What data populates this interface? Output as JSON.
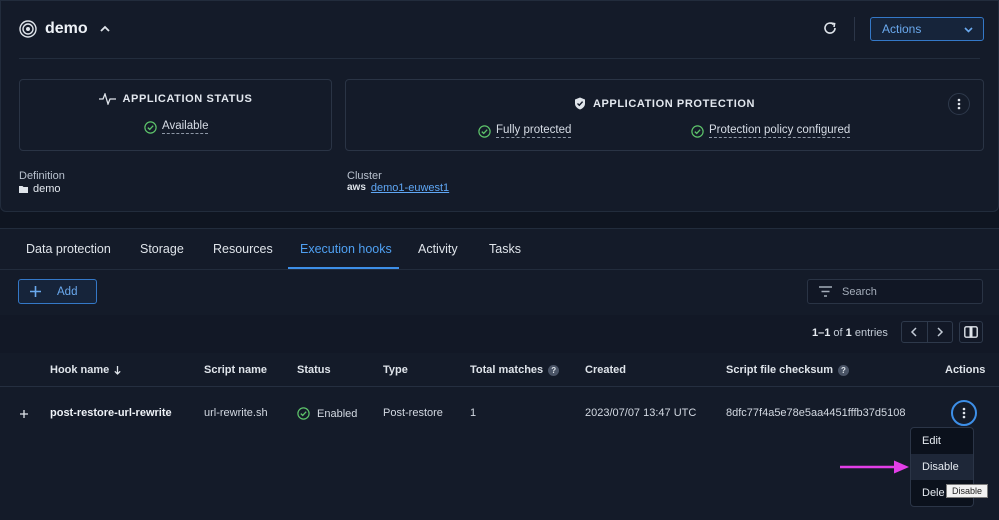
{
  "app": {
    "name": "demo",
    "actions_label": "Actions"
  },
  "status": {
    "title": "APPLICATION STATUS",
    "value": "Available"
  },
  "protection": {
    "title": "APPLICATION PROTECTION",
    "item1": "Fully protected",
    "item2": "Protection policy configured"
  },
  "definition": {
    "label": "Definition",
    "value": "demo"
  },
  "cluster": {
    "label": "Cluster",
    "provider": "aws",
    "value": "demo1-euwest1"
  },
  "tabs": [
    {
      "label": "Data protection"
    },
    {
      "label": "Storage"
    },
    {
      "label": "Resources"
    },
    {
      "label": "Execution hooks",
      "active": true
    },
    {
      "label": "Activity"
    },
    {
      "label": "Tasks"
    }
  ],
  "toolbar": {
    "add_label": "Add",
    "search_placeholder": "Search"
  },
  "pagination": {
    "range": "1–1",
    "of_word": "of",
    "total": "1",
    "entries_word": "entries"
  },
  "table": {
    "columns": {
      "hook_name": "Hook name",
      "script_name": "Script name",
      "status": "Status",
      "type": "Type",
      "total_matches": "Total matches",
      "created": "Created",
      "checksum": "Script file checksum",
      "actions": "Actions"
    },
    "rows": [
      {
        "hook_name": "post-restore-url-rewrite",
        "script_name": "url-rewrite.sh",
        "status": "Enabled",
        "type": "Post-restore",
        "total_matches": "1",
        "created": "2023/07/07 13:47 UTC",
        "checksum": "8dfc77f4a5e78e5aa4451fffb37d5108"
      }
    ]
  },
  "row_menu": {
    "items": [
      "Edit",
      "Disable",
      "Dele"
    ]
  },
  "tooltip": "Disable",
  "colors": {
    "accent": "#3d8fe8",
    "success": "#5ec46b",
    "annotation_arrow": "#e23ee8"
  },
  "icons": {
    "app_logo": "concentric-circles-icon",
    "refresh": "refresh-icon",
    "status": "heartbeat-icon",
    "protection": "shield-icon",
    "check": "check-circle-icon",
    "more": "kebab-icon",
    "filter": "filter-icon",
    "expand": "plus-icon",
    "sort": "sort-down-arrow-icon"
  }
}
